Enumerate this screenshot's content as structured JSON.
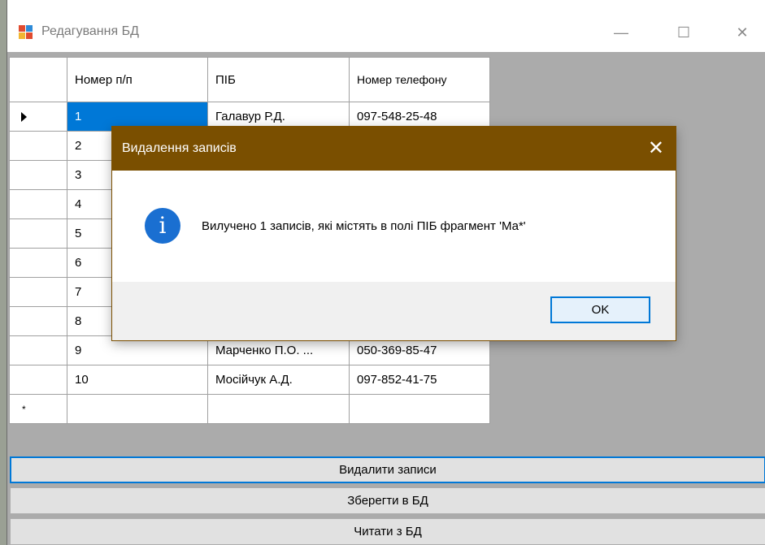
{
  "window": {
    "title": "Редагування БД",
    "controls": {
      "minimize": "—",
      "maximize": "☐",
      "close": "✕"
    }
  },
  "grid": {
    "columns": [
      "Номер п/п",
      "ПІБ",
      "Номер телефону"
    ],
    "rows": [
      {
        "num": "1",
        "name": "Галавур Р.Д.",
        "phone": "097-548-25-48"
      },
      {
        "num": "2",
        "name": "",
        "phone": ""
      },
      {
        "num": "3",
        "name": "",
        "phone": ""
      },
      {
        "num": "4",
        "name": "",
        "phone": ""
      },
      {
        "num": "5",
        "name": "",
        "phone": ""
      },
      {
        "num": "6",
        "name": "",
        "phone": ""
      },
      {
        "num": "7",
        "name": "",
        "phone": ""
      },
      {
        "num": "8",
        "name": "",
        "phone": ""
      },
      {
        "num": "9",
        "name": "Марченко П.О. ...",
        "phone": "050-369-85-47"
      },
      {
        "num": "10",
        "name": "Мосійчук А.Д.",
        "phone": "097-852-41-75"
      }
    ],
    "current_row_marker": "▶",
    "new_row_marker": "*"
  },
  "buttons": {
    "delete": "Видалити записи",
    "save": "Зберегти в БД",
    "read": "Читати з БД"
  },
  "dialog": {
    "title": "Видалення записів",
    "close": "✕",
    "icon": "info-icon",
    "icon_glyph": "i",
    "message": "Вилучено 1 записів, які містять в полі ПІБ фрагмент 'Ма*'",
    "ok": "OK"
  },
  "colors": {
    "dialog_title_bg": "#7a4f00",
    "selection": "#0078d7",
    "info_icon": "#1a6fd1"
  }
}
